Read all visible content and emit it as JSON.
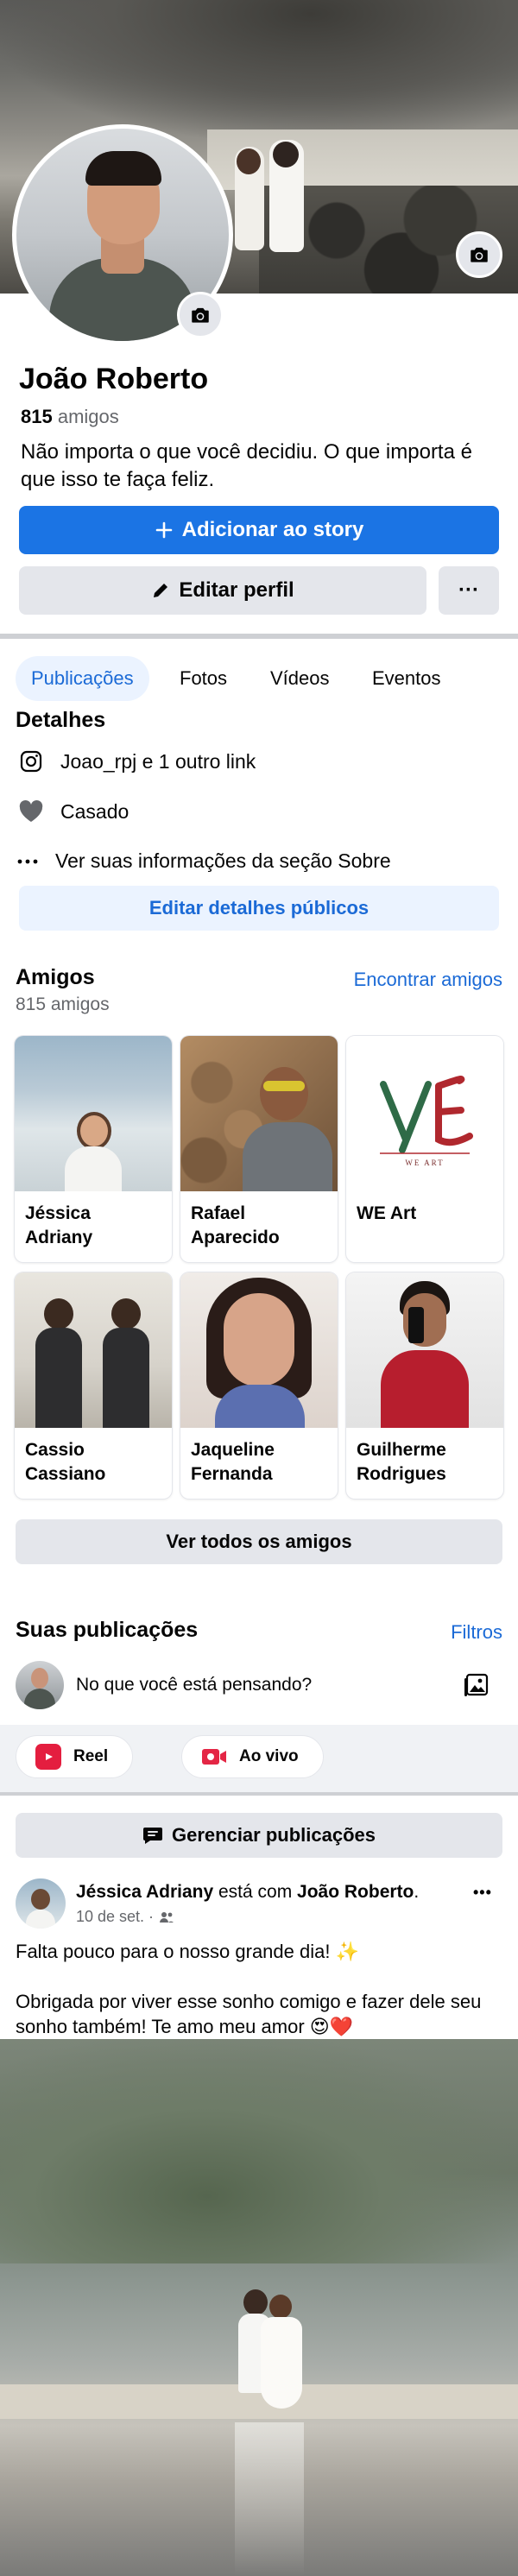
{
  "profile": {
    "name": "João Roberto",
    "friends_number": "815",
    "friends_label": "amigos",
    "bio": "Não importa o que você decidiu. O que importa é que isso te faça feliz."
  },
  "actions": {
    "add_story": "Adicionar ao story",
    "edit_profile": "Editar perfil",
    "more": "···"
  },
  "tabs": [
    "Publicações",
    "Fotos",
    "Vídeos",
    "Eventos"
  ],
  "details": {
    "title": "Detalhes",
    "instagram": "Joao_rpj e 1 outro link",
    "relationship": "Casado",
    "about": "Ver suas informações da seção Sobre",
    "edit_button": "Editar detalhes públicos"
  },
  "friends": {
    "title": "Amigos",
    "count_label": "815 amigos",
    "find_link": "Encontrar amigos",
    "list": [
      {
        "line1": "Jéssica",
        "line2": "Adriany"
      },
      {
        "line1": "Rafael",
        "line2": "Aparecido"
      },
      {
        "line1": "WE Art",
        "line2": ""
      },
      {
        "line1": "Cassio",
        "line2": "Cassiano"
      },
      {
        "line1": "Jaqueline",
        "line2": "Fernanda"
      },
      {
        "line1": "Guilherme",
        "line2": "Rodrigues"
      }
    ],
    "see_all": "Ver todos os amigos"
  },
  "posts": {
    "title": "Suas publicações",
    "filters": "Filtros",
    "composer_placeholder": "No que você está pensando?",
    "reel": "Reel",
    "live": "Ao vivo",
    "manage": "Gerenciar publicações"
  },
  "post": {
    "author": "Jéssica Adriany",
    "with_text": " está com ",
    "tagged": "João Roberto",
    "period": ".",
    "date": "10 de set. ·",
    "text1": "Falta pouco para o nosso grande dia! ✨",
    "text2": "Obrigada por viver esse sonho comigo e fazer dele seu sonho também! Te amo meu amor 😍❤️",
    "more": "•••"
  },
  "logo_text": "WE ART",
  "colors": {
    "primary": "#1b74e4",
    "link": "#1b6ad6",
    "gray_button": "#e4e6eb",
    "light_blue": "#ebf3ff",
    "reel_red": "#e41e3f",
    "live_red": "#e42645"
  }
}
